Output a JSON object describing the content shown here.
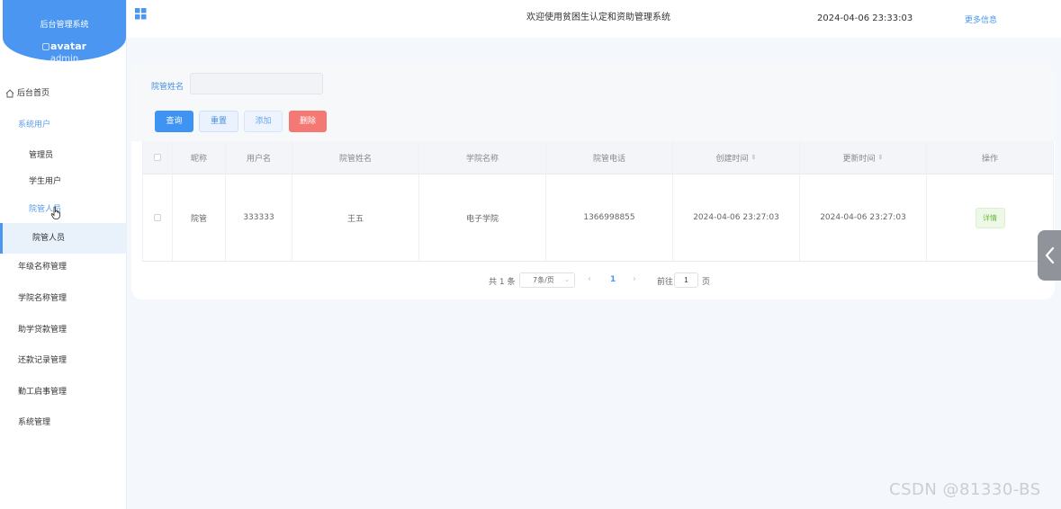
{
  "brand": {
    "title": "后台管理系统",
    "avatar_alt": "avatar",
    "username": "admin"
  },
  "menu": [
    {
      "label": "后台首页"
    },
    {
      "label": "系统用户"
    },
    {
      "label": "管理员"
    },
    {
      "label": "学生用户"
    },
    {
      "label": "院管人员"
    },
    {
      "label": "院管人员"
    },
    {
      "label": "年级名称管理"
    },
    {
      "label": "学院名称管理"
    },
    {
      "label": "助学贷款管理"
    },
    {
      "label": "还款记录管理"
    },
    {
      "label": "勤工启事管理"
    },
    {
      "label": "系统管理"
    }
  ],
  "header": {
    "title": "欢迎使用贫困生认定和资助管理系统",
    "datetime": "2024-04-06 23:33:03",
    "more": "更多信息"
  },
  "search": {
    "label": "院管姓名",
    "value": "",
    "placeholder": ""
  },
  "buttons": {
    "query": "查询",
    "reset": "重置",
    "add": "添加",
    "delete": "删除"
  },
  "table": {
    "headers": [
      "昵称",
      "用户名",
      "院管姓名",
      "学院名称",
      "院管电话",
      "创建时间",
      "更新时间",
      "操作"
    ],
    "rows": [
      {
        "nickname": "院管",
        "username": "333333",
        "name": "王五",
        "college": "电子学院",
        "phone": "1366998855",
        "created": "2024-04-06 23:27:03",
        "updated": "2024-04-06 23:27:03",
        "action": "详情"
      }
    ]
  },
  "pagination": {
    "total": "共 1 条",
    "page_size": "7条/页",
    "current": "1",
    "goto": "前往",
    "goto_value": "1",
    "unit": "页"
  },
  "watermark": "CSDN @81330-BS",
  "colors": {
    "primary": "#4a96f0",
    "danger": "#f47874",
    "success": "#6bbb3a"
  }
}
